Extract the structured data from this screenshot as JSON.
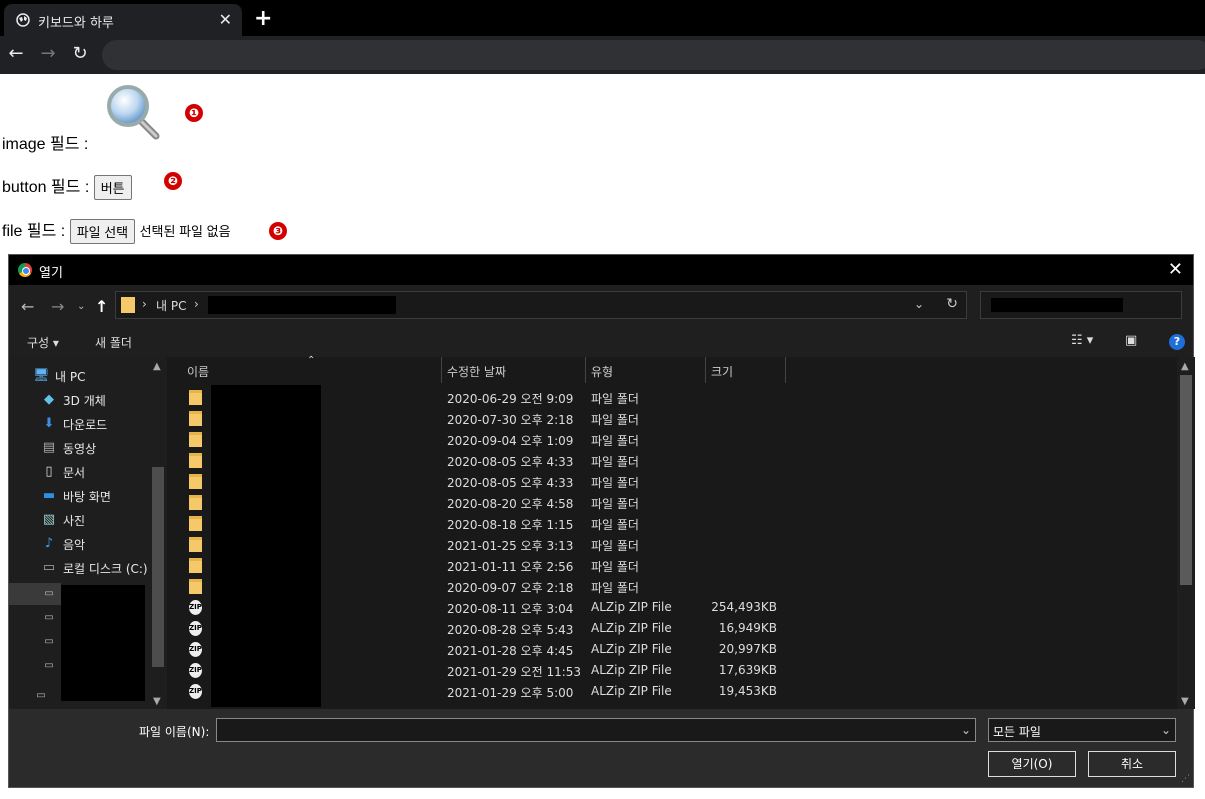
{
  "browser": {
    "tab_title": "키보드와 하루",
    "close_glyph": "✕",
    "newtab_glyph": "+"
  },
  "page": {
    "image_label": "image 필드 :",
    "button_label": "button 필드 :",
    "button_text": "버튼",
    "file_label": "file 필드 :",
    "file_button_text": "파일 선택",
    "file_status": "선택된 파일 없음",
    "markers": [
      "❶",
      "❷",
      "❸"
    ]
  },
  "dialog": {
    "title": "열기",
    "path_pc": "내 PC",
    "organize": "구성",
    "new_folder": "새 폴더",
    "help": "?",
    "nav_items": [
      {
        "label": "내 PC",
        "icon": "monitor-icon"
      },
      {
        "label": "3D 개체",
        "icon": "cube-icon"
      },
      {
        "label": "다운로드",
        "icon": "download-icon"
      },
      {
        "label": "동영상",
        "icon": "video-icon"
      },
      {
        "label": "문서",
        "icon": "document-icon"
      },
      {
        "label": "바탕 화면",
        "icon": "desktop-icon"
      },
      {
        "label": "사진",
        "icon": "picture-icon"
      },
      {
        "label": "음악",
        "icon": "music-icon"
      },
      {
        "label": "로컬 디스크 (C:)",
        "icon": "disk-icon"
      }
    ],
    "columns": {
      "name": "이름",
      "date": "수정한 날짜",
      "type": "유형",
      "size": "크기"
    },
    "files": [
      {
        "kind": "folder",
        "date": "2020-06-29 오전 9:09",
        "type": "파일 폴더",
        "size": ""
      },
      {
        "kind": "folder",
        "date": "2020-07-30 오후 2:18",
        "type": "파일 폴더",
        "size": ""
      },
      {
        "kind": "folder",
        "date": "2020-09-04 오후 1:09",
        "type": "파일 폴더",
        "size": ""
      },
      {
        "kind": "folder",
        "date": "2020-08-05 오후 4:33",
        "type": "파일 폴더",
        "size": ""
      },
      {
        "kind": "folder",
        "date": "2020-08-05 오후 4:33",
        "type": "파일 폴더",
        "size": ""
      },
      {
        "kind": "folder",
        "date": "2020-08-20 오후 4:58",
        "type": "파일 폴더",
        "size": ""
      },
      {
        "kind": "folder",
        "date": "2020-08-18 오후 1:15",
        "type": "파일 폴더",
        "size": ""
      },
      {
        "kind": "folder",
        "date": "2021-01-25 오후 3:13",
        "type": "파일 폴더",
        "size": ""
      },
      {
        "kind": "folder",
        "date": "2021-01-11 오후 2:56",
        "type": "파일 폴더",
        "size": ""
      },
      {
        "kind": "folder",
        "date": "2020-09-07 오후 2:18",
        "type": "파일 폴더",
        "size": ""
      },
      {
        "kind": "zip",
        "date": "2020-08-11 오후 3:04",
        "type": "ALZip ZIP File",
        "size": "254,493KB"
      },
      {
        "kind": "zip",
        "date": "2020-08-28 오후 5:43",
        "type": "ALZip ZIP File",
        "size": "16,949KB"
      },
      {
        "kind": "zip",
        "date": "2021-01-28 오후 4:45",
        "type": "ALZip ZIP File",
        "size": "20,997KB"
      },
      {
        "kind": "zip",
        "date": "2021-01-29 오전 11:53",
        "type": "ALZip ZIP File",
        "size": "17,639KB"
      },
      {
        "kind": "zip",
        "date": "2021-01-29 오후 5:00",
        "type": "ALZip ZIP File",
        "size": "19,453KB"
      }
    ],
    "filename_label": "파일 이름(N):",
    "filename_value": "",
    "filter_value": "모든 파일",
    "open_button": "열기(O)",
    "cancel_button": "취소"
  }
}
